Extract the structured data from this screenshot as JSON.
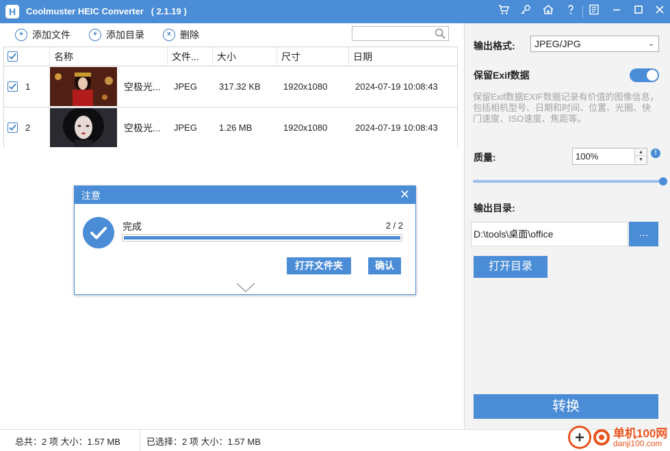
{
  "app": {
    "title": "Coolmuster HEIC Converter   ( 2.1.19 )",
    "logo_letter": "H"
  },
  "titlebar_icons": [
    "cart-icon",
    "key-icon",
    "home-icon",
    "help-icon",
    "feedback-icon",
    "minimize-icon",
    "maximize-icon",
    "close-icon"
  ],
  "toolbar": {
    "add_file": "添加文件",
    "add_dir": "添加目录",
    "delete": "删除",
    "search_placeholder": ""
  },
  "table": {
    "headers": [
      "名称",
      "文件...",
      "大小",
      "尺寸",
      "日期"
    ],
    "rows": [
      {
        "index": "1",
        "name": "空极光...",
        "type": "JPEG",
        "size": "317.32 KB",
        "dims": "1920x1080",
        "date": "2024-07-19 10:08:43"
      },
      {
        "index": "2",
        "name": "空极光...",
        "type": "JPEG",
        "size": "1.26 MB",
        "dims": "1920x1080",
        "date": "2024-07-19 10:08:43"
      }
    ]
  },
  "dialog": {
    "title": "注意",
    "status": "完成",
    "count": "2 / 2",
    "progress": 1.0,
    "open_folder": "打开文件夹",
    "ok": "确认"
  },
  "panel": {
    "format_label": "输出格式:",
    "format_value": "JPEG/JPG",
    "exif_label": "保留Exif数据",
    "exif_enabled": true,
    "exif_desc": "保留Exif数据EXIF数据记录有价值的图像信息，包括相机型号、日期和时间、位置、光圈、快门速度、ISO速度、焦距等。",
    "quality_label": "质量:",
    "quality_value": "100%",
    "quality_slider": 1.0,
    "output_dir_label": "输出目录:",
    "output_dir_value": "D:\\tools\\桌面\\office",
    "browse": "...",
    "open_dir": "打开目录",
    "convert": "转换"
  },
  "status": {
    "total": "总共：2 项 大小：1.57 MB",
    "selected": "已选择：2 项 大小：1.57 MB"
  },
  "watermark": {
    "line1": "单机100网",
    "line2": "danji100.com"
  },
  "colors": {
    "accent": "#4a8cd6",
    "watermark": "#e8541d"
  }
}
